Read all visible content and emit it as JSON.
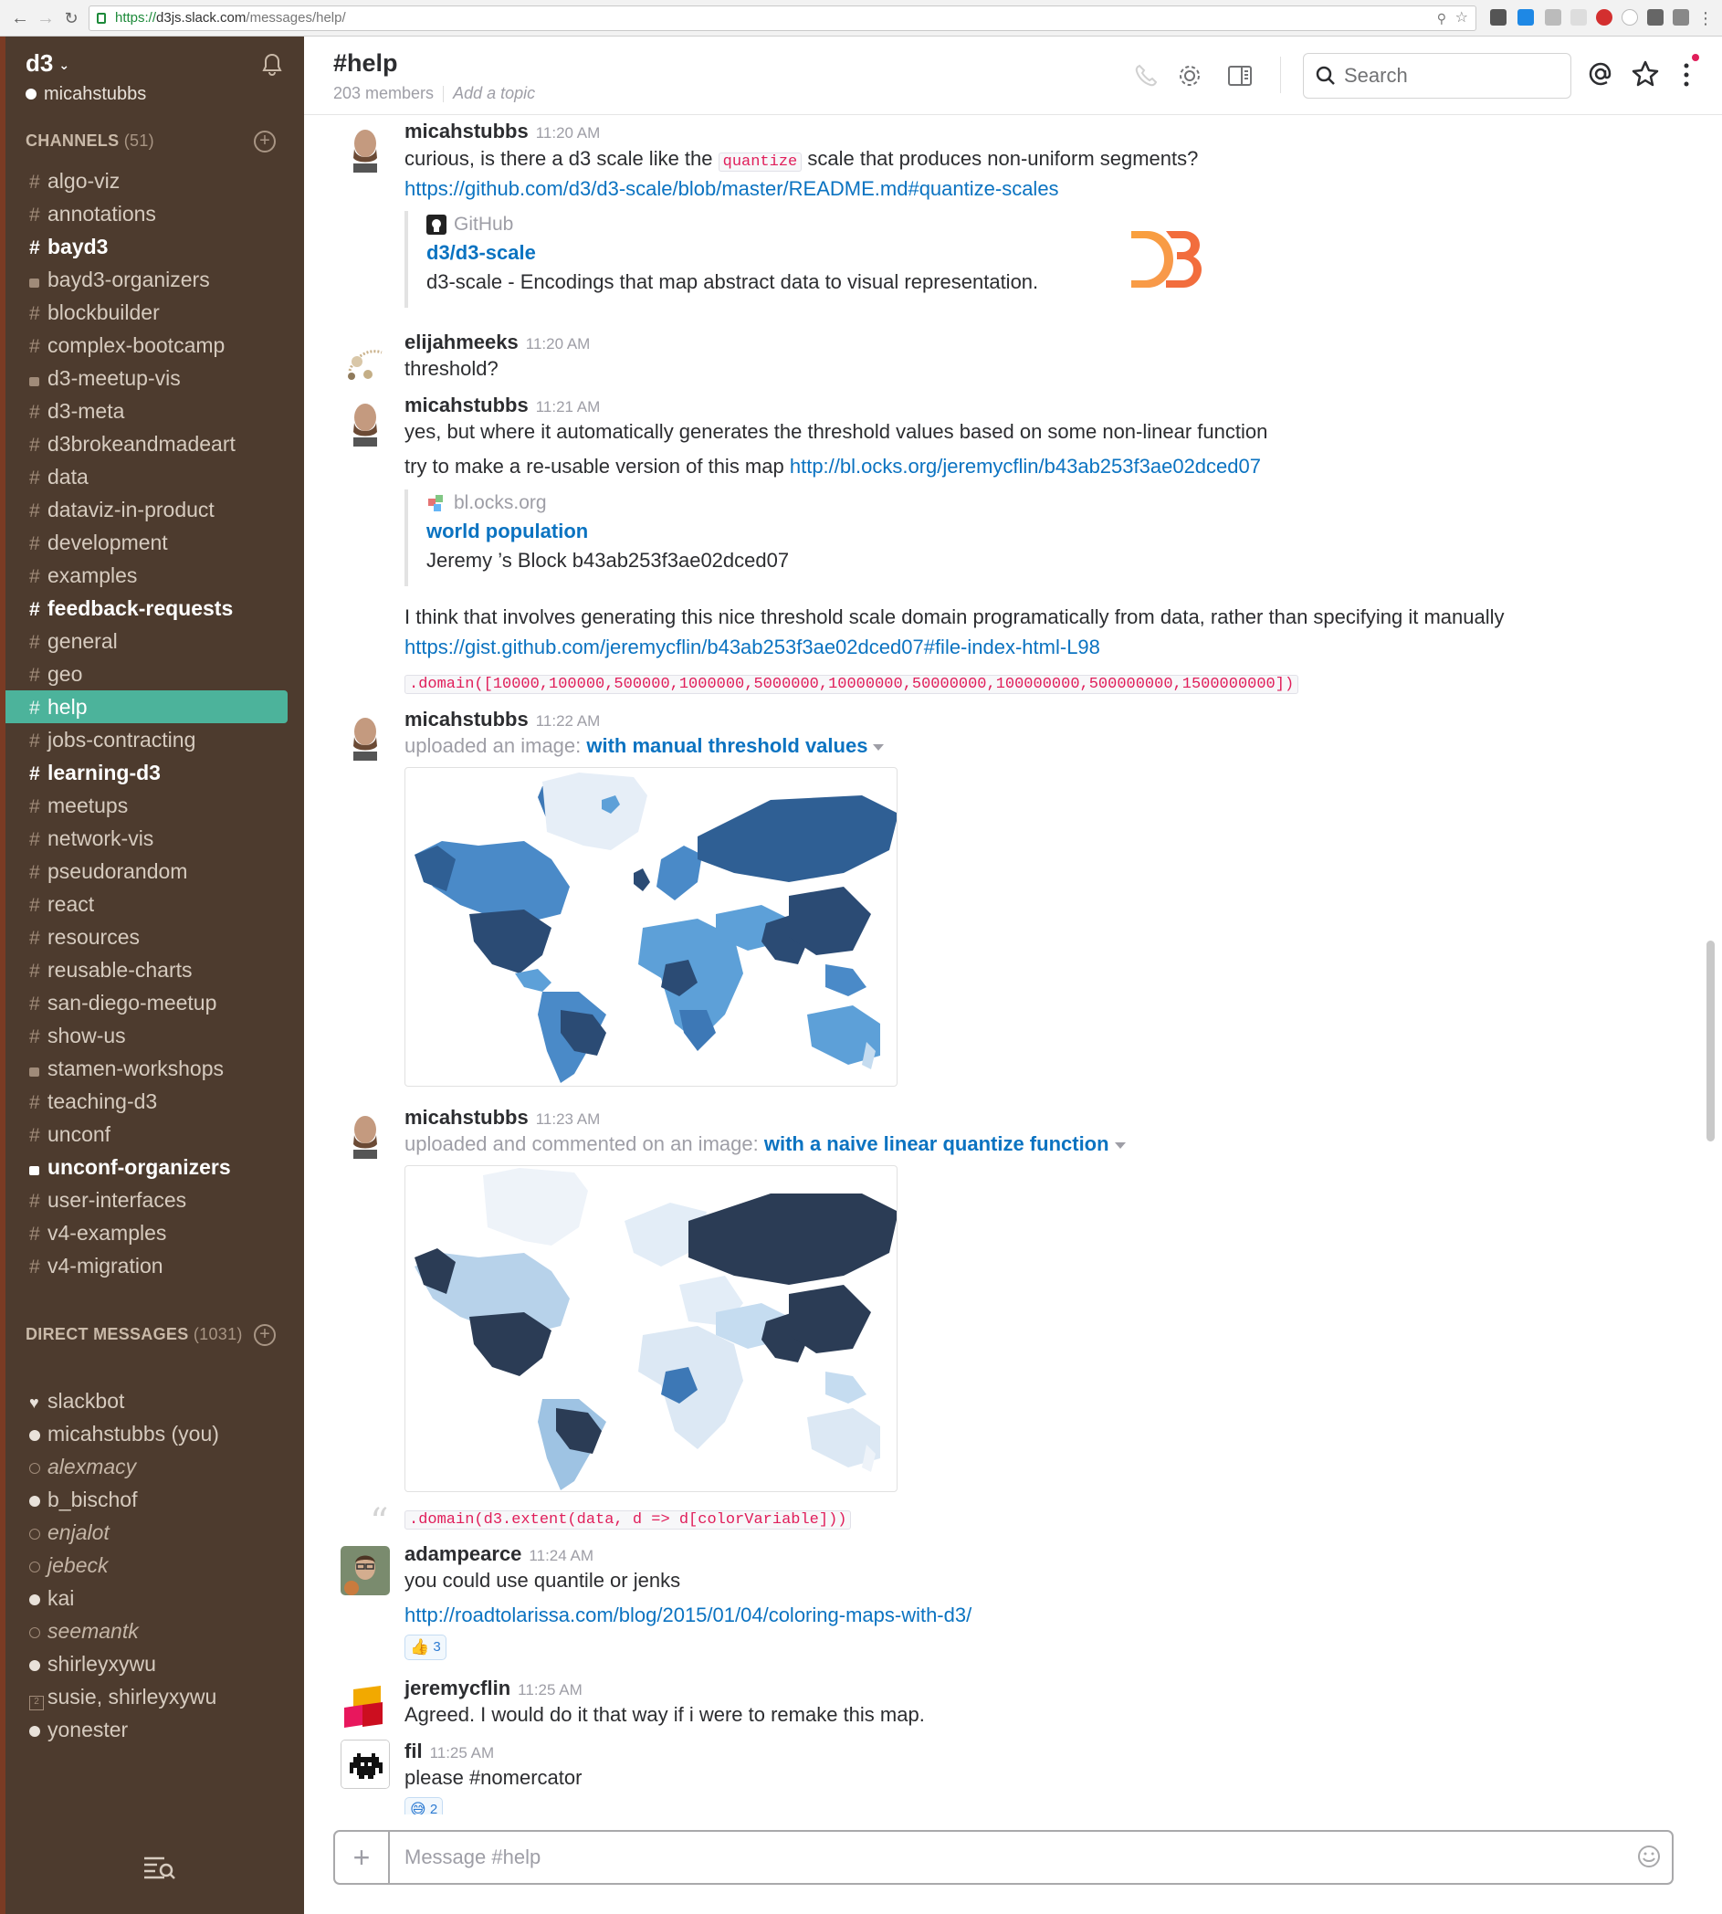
{
  "browser": {
    "url_protocol": "https://",
    "url_host": "d3js.slack.com",
    "url_path": "/messages/help/"
  },
  "sidebar": {
    "team_name": "d3",
    "current_user": "micahstubbs",
    "channels_label": "CHANNELS",
    "channels_count": "(51)",
    "channels": [
      {
        "name": "algo-viz",
        "type": "public",
        "unread": false
      },
      {
        "name": "annotations",
        "type": "public",
        "unread": false
      },
      {
        "name": "bayd3",
        "type": "public",
        "unread": true
      },
      {
        "name": "bayd3-organizers",
        "type": "private",
        "unread": false
      },
      {
        "name": "blockbuilder",
        "type": "public",
        "unread": false
      },
      {
        "name": "complex-bootcamp",
        "type": "public",
        "unread": false
      },
      {
        "name": "d3-meetup-vis",
        "type": "private",
        "unread": false
      },
      {
        "name": "d3-meta",
        "type": "public",
        "unread": false
      },
      {
        "name": "d3brokeandmadeart",
        "type": "public",
        "unread": false
      },
      {
        "name": "data",
        "type": "public",
        "unread": false
      },
      {
        "name": "dataviz-in-product",
        "type": "public",
        "unread": false
      },
      {
        "name": "development",
        "type": "public",
        "unread": false
      },
      {
        "name": "examples",
        "type": "public",
        "unread": false
      },
      {
        "name": "feedback-requests",
        "type": "public",
        "unread": true
      },
      {
        "name": "general",
        "type": "public",
        "unread": false
      },
      {
        "name": "geo",
        "type": "public",
        "unread": false
      },
      {
        "name": "help",
        "type": "public",
        "unread": false,
        "active": true
      },
      {
        "name": "jobs-contracting",
        "type": "public",
        "unread": false
      },
      {
        "name": "learning-d3",
        "type": "public",
        "unread": true
      },
      {
        "name": "meetups",
        "type": "public",
        "unread": false
      },
      {
        "name": "network-vis",
        "type": "public",
        "unread": false
      },
      {
        "name": "pseudorandom",
        "type": "public",
        "unread": false
      },
      {
        "name": "react",
        "type": "public",
        "unread": false
      },
      {
        "name": "resources",
        "type": "public",
        "unread": false
      },
      {
        "name": "reusable-charts",
        "type": "public",
        "unread": false
      },
      {
        "name": "san-diego-meetup",
        "type": "public",
        "unread": false
      },
      {
        "name": "show-us",
        "type": "public",
        "unread": false
      },
      {
        "name": "stamen-workshops",
        "type": "private",
        "unread": false
      },
      {
        "name": "teaching-d3",
        "type": "public",
        "unread": false
      },
      {
        "name": "unconf",
        "type": "public",
        "unread": false
      },
      {
        "name": "unconf-organizers",
        "type": "private",
        "unread": true
      },
      {
        "name": "user-interfaces",
        "type": "public",
        "unread": false
      },
      {
        "name": "v4-examples",
        "type": "public",
        "unread": false
      },
      {
        "name": "v4-migration",
        "type": "public",
        "unread": false
      }
    ],
    "dm_label": "DIRECT MESSAGES",
    "dm_count": "(1031)",
    "dms": [
      {
        "name": "slackbot",
        "status": "heart"
      },
      {
        "name": "micahstubbs (you)",
        "status": "on"
      },
      {
        "name": "alexmacy",
        "status": "off"
      },
      {
        "name": "b_bischof",
        "status": "on"
      },
      {
        "name": "enjalot",
        "status": "off"
      },
      {
        "name": "jebeck",
        "status": "off"
      },
      {
        "name": "kai",
        "status": "on"
      },
      {
        "name": "seemantk",
        "status": "off"
      },
      {
        "name": "shirleyxywu",
        "status": "on"
      },
      {
        "name": "susie, shirleyxywu",
        "status": "grp"
      },
      {
        "name": "yonester",
        "status": "on"
      }
    ]
  },
  "header": {
    "title": "#help",
    "members": "203 members",
    "topic_placeholder": "Add a topic",
    "search_placeholder": "Search"
  },
  "messages": {
    "m1": {
      "user": "micahstubbs",
      "time": "11:20 AM",
      "text_before": "curious, is there a d3 scale like the ",
      "code": "quantize",
      "text_after": " scale that produces non-uniform segments?",
      "link": "https://github.com/d3/d3-scale/blob/master/README.md#quantize-scales",
      "attach_service": "GitHub",
      "attach_title": "d3/d3-scale",
      "attach_desc": "d3-scale - Encodings that map abstract data to visual representation."
    },
    "m2": {
      "user": "elijahmeeks",
      "time": "11:20 AM",
      "text": "threshold?"
    },
    "m3": {
      "user": "micahstubbs",
      "time": "11:21 AM",
      "text1": "yes, but where it automatically generates the threshold values based on some non-linear function",
      "text2": "try to make a re-usable version of this map ",
      "link2": "http://bl.ocks.org/jeremycflin/b43ab253f3ae02dced07",
      "attach_service": "bl.ocks.org",
      "attach_title": "world population",
      "attach_desc": "Jeremy ’s Block b43ab253f3ae02dced07",
      "text3": "I think that involves generating this nice threshold scale domain programatically from data, rather than specifying it manually",
      "link3": "https://gist.github.com/jeremycflin/b43ab253f3ae02dced07#file-index-html-L98",
      "code3": ".domain([10000,100000,500000,1000000,5000000,10000000,50000000,100000000,500000000,1500000000])"
    },
    "m4": {
      "user": "micahstubbs",
      "time": "11:22 AM",
      "prefix": "uploaded an image: ",
      "title": "with manual threshold values"
    },
    "m5": {
      "user": "micahstubbs",
      "time": "11:23 AM",
      "prefix": "uploaded and commented on an image: ",
      "title": "with a naive linear quantize function",
      "comment_code": ".domain(d3.extent(data, d => d[colorVariable]))"
    },
    "m6": {
      "user": "adampearce",
      "time": "11:24 AM",
      "text": "you could use quantile or jenks",
      "link": "http://roadtolarissa.com/blog/2015/01/04/coloring-maps-with-d3/",
      "reaction_count": "3"
    },
    "m7": {
      "user": "jeremycflin",
      "time": "11:25 AM",
      "text": "Agreed. I would do it that way if i were to remake this map."
    },
    "m8": {
      "user": "fil",
      "time": "11:25 AM",
      "text": "please #nomercator",
      "reaction_count": "2"
    }
  },
  "composer": {
    "placeholder": "Message #help"
  },
  "colors": {
    "sidebar": "#4d3b2e",
    "active_channel": "#4cb39b",
    "link": "#0b73c1",
    "code": "#e01e5a"
  }
}
